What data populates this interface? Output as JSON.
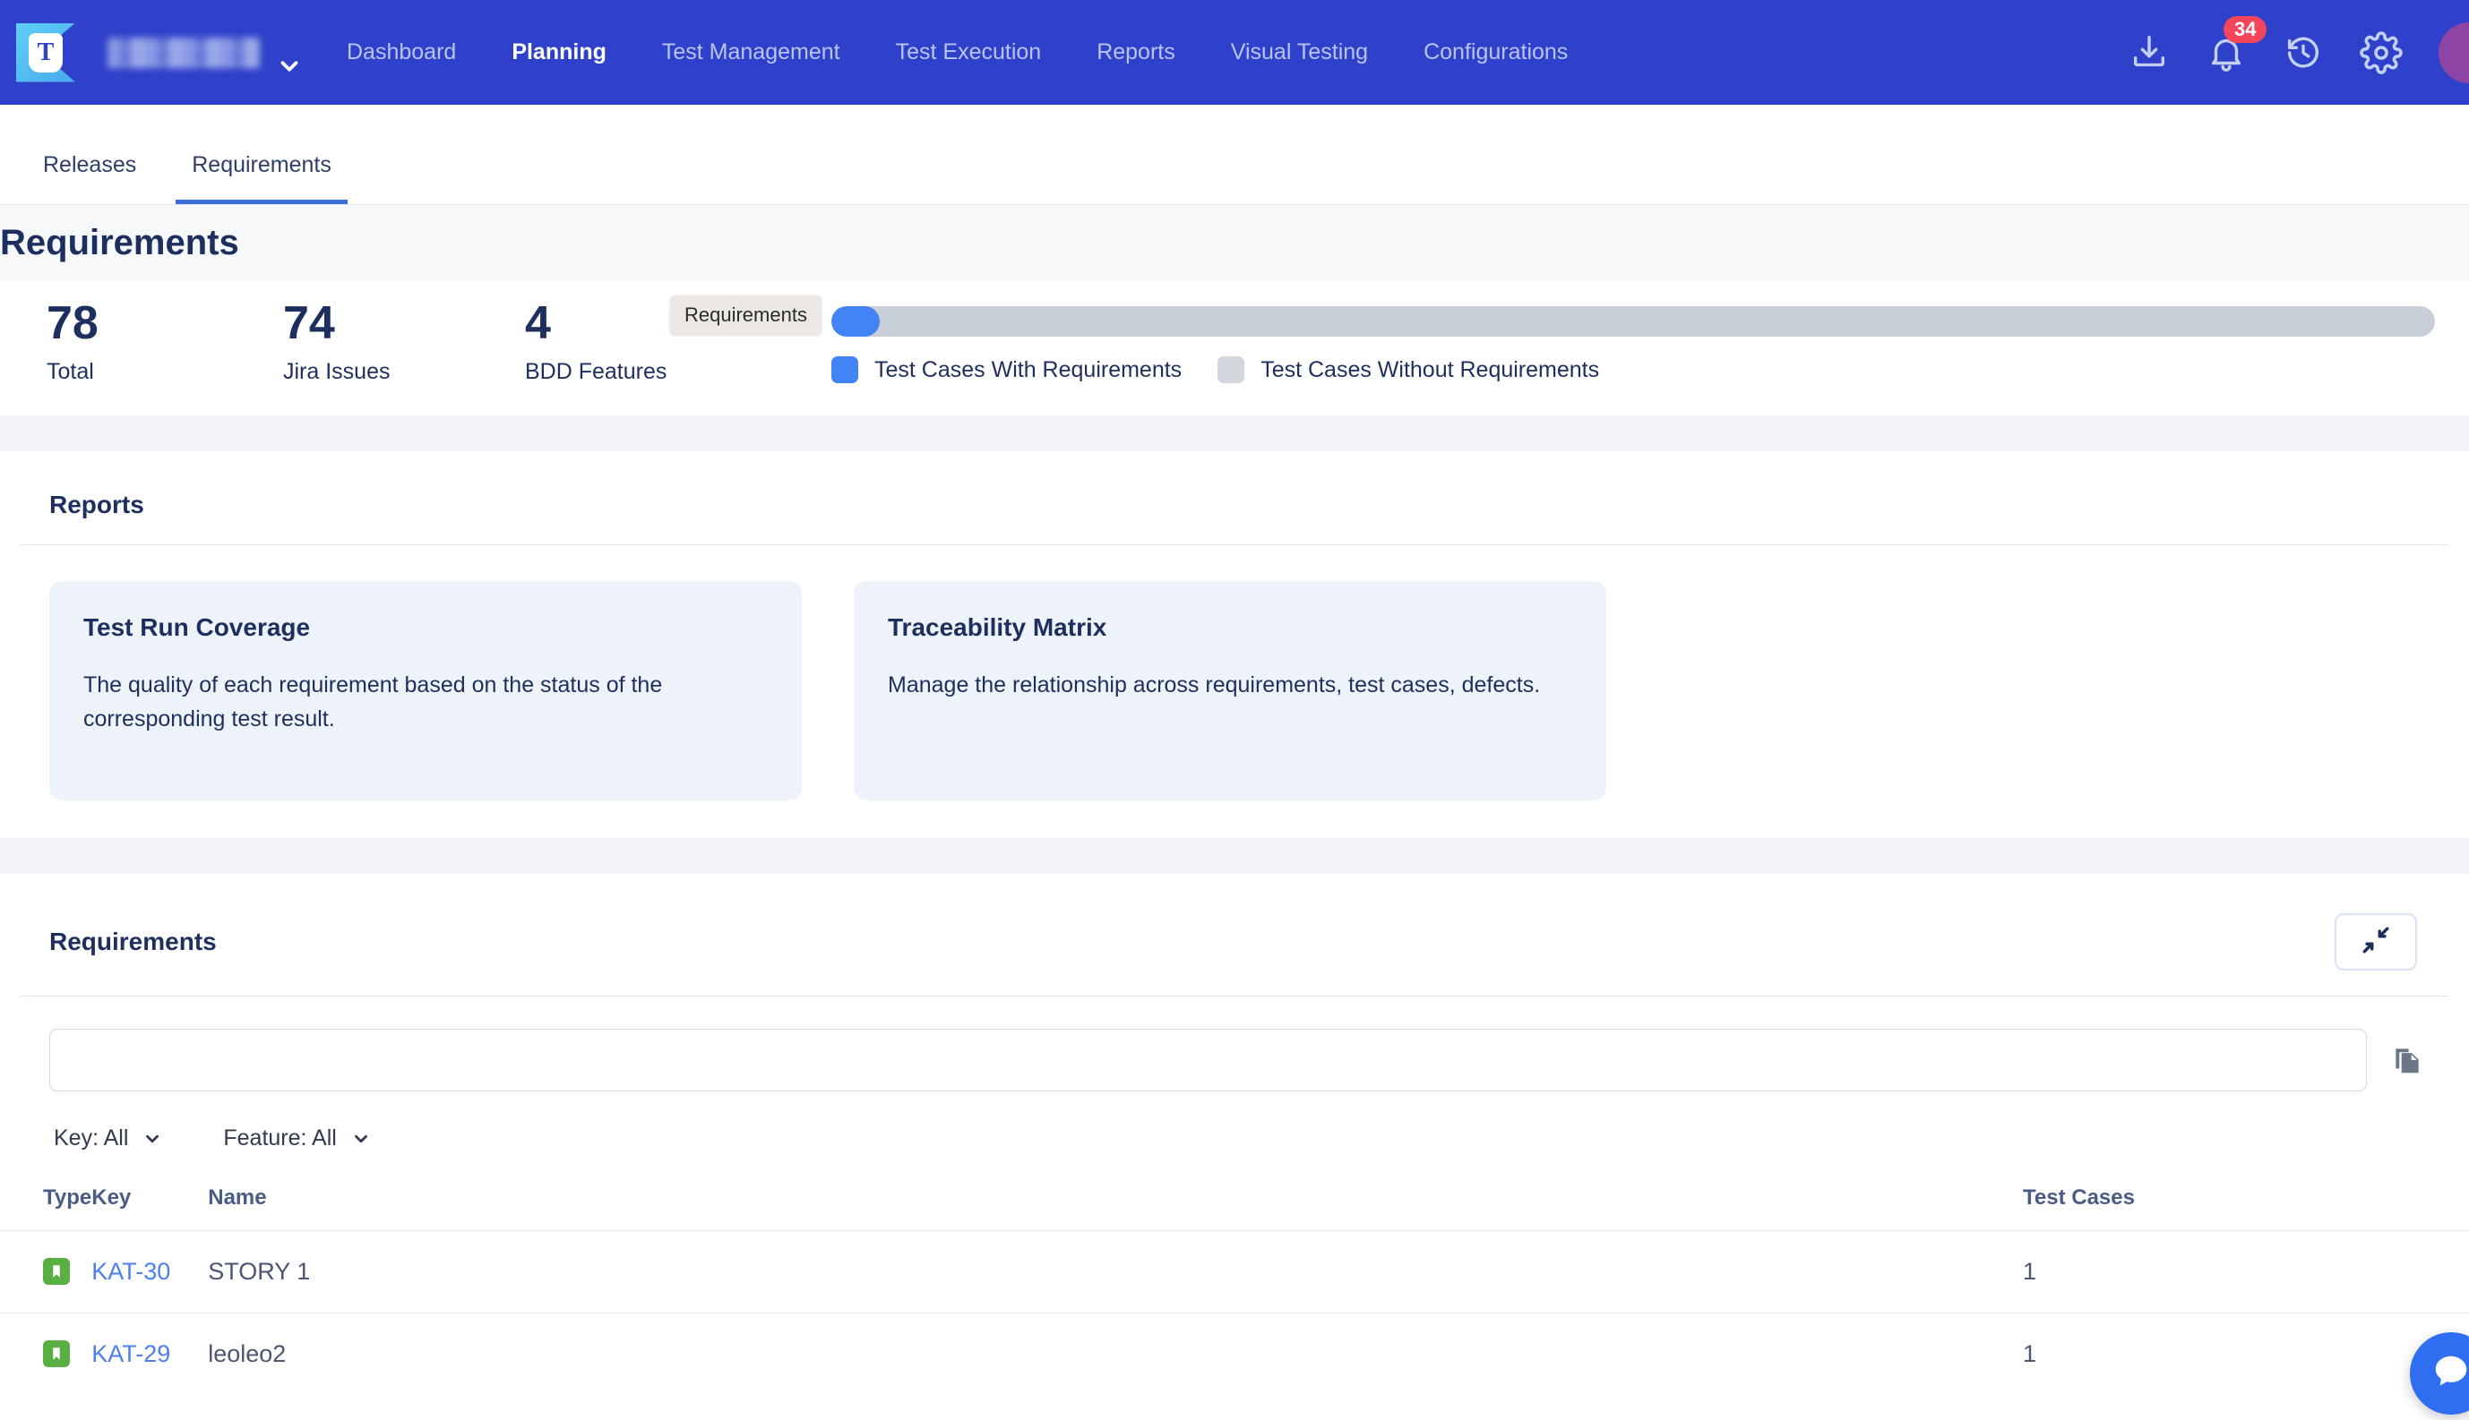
{
  "topbar": {
    "logo_letter": "T",
    "project_name": "",
    "nav": [
      {
        "label": "Dashboard",
        "active": false
      },
      {
        "label": "Planning",
        "active": true
      },
      {
        "label": "Test Management",
        "active": false
      },
      {
        "label": "Test Execution",
        "active": false
      },
      {
        "label": "Reports",
        "active": false
      },
      {
        "label": "Visual Testing",
        "active": false
      },
      {
        "label": "Configurations",
        "active": false
      }
    ],
    "notification_count": "34",
    "accent_color": "#2f40ca",
    "badge_color": "#f4465b",
    "avatar_color": "#8e44a4"
  },
  "subtabs": [
    {
      "label": "Releases",
      "active": false
    },
    {
      "label": "Requirements",
      "active": true
    }
  ],
  "page": {
    "title": "Requirements"
  },
  "stats": [
    {
      "value": "78",
      "label": "Total"
    },
    {
      "value": "74",
      "label": "Jira Issues"
    },
    {
      "value": "4",
      "label": "BDD Features"
    }
  ],
  "coverage_bar": {
    "tooltip": "Requirements",
    "fill_percent": 3,
    "fill_color": "#4284f5",
    "track_color": "#c8cfd8",
    "legend": [
      {
        "label": "Test Cases With Requirements",
        "color": "#4284f5"
      },
      {
        "label": "Test Cases Without Requirements",
        "color": "#d2d7de"
      }
    ]
  },
  "reports": {
    "heading": "Reports",
    "cards": [
      {
        "title": "Test Run Coverage",
        "description": "The quality of each requirement based on the status of the corresponding test result."
      },
      {
        "title": "Traceability Matrix",
        "description": "Manage the relationship across requirements, test cases, defects."
      }
    ]
  },
  "requirements_table": {
    "heading": "Requirements",
    "search": {
      "value": "",
      "placeholder": ""
    },
    "filters": [
      {
        "label": "Key: All"
      },
      {
        "label": "Feature: All"
      }
    ],
    "columns": [
      "Type",
      "Key",
      "Name",
      "Test Cases"
    ],
    "rows": [
      {
        "type_icon": "jira-story-icon",
        "key": "KAT-30",
        "name": "STORY 1",
        "test_cases": "1"
      },
      {
        "type_icon": "jira-story-icon",
        "key": "KAT-29",
        "name": "leoleo2",
        "test_cases": "1"
      }
    ]
  }
}
